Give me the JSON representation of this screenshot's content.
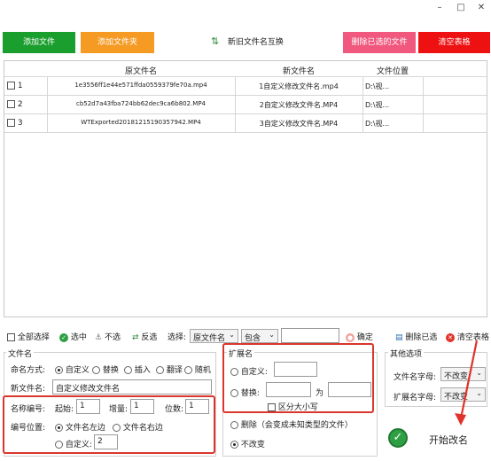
{
  "window": {
    "min_icon": "minimize-icon",
    "max_icon": "maximize-icon",
    "close_icon": "close-icon",
    "min": "–",
    "max": "□",
    "close": "✕"
  },
  "toolbar": {
    "add_file": "添加文件",
    "add_folder": "添加文件夹",
    "swap": "新旧文件名互换",
    "delete_selected": "删除已选的文件",
    "clear_table": "清空表格",
    "colors": {
      "add_file": "#1a9e2e",
      "add_folder": "#f59a23",
      "delete_selected": "#f0587e",
      "clear_table": "#ee1111"
    }
  },
  "table": {
    "headers": [
      "原文件名",
      "新文件名",
      "文件位置"
    ],
    "rows": [
      {
        "num": "1",
        "original": "1e3556ff1e44e571ffda0559379fe70a.mp4",
        "new": "1自定义修改文件名.mp4",
        "location": "D:\\视..."
      },
      {
        "num": "2",
        "original": "cb52d7a43fba724bb62dec9ca6b802.MP4",
        "new": "2自定义修改文件名.MP4",
        "location": "D:\\视..."
      },
      {
        "num": "3",
        "original": "WTExported20181215190357942.MP4",
        "new": "3自定义修改文件名.MP4",
        "location": "D:\\视..."
      }
    ]
  },
  "filterbar": {
    "select_all": "全部选择",
    "select": "选中",
    "deselect": "不选",
    "invert": "反选",
    "choose_label": "选择:",
    "field_value": "原文件名",
    "op_value": "包含",
    "confirm": "确定",
    "delete_selected": "删除已选",
    "clear_table": "清空表格"
  },
  "filename": {
    "legend": "文件名",
    "naming_label": "命名方式:",
    "modes": [
      "自定义",
      "替换",
      "插入",
      "翻译",
      "随机"
    ],
    "new_name_label": "新文件名:",
    "new_name_value": "自定义修改文件名",
    "numbering_label": "名称编号:",
    "start_label": "起始:",
    "start_value": "1",
    "step_label": "增量:",
    "step_value": "1",
    "digits_label": "位数:",
    "digits_value": "1",
    "position_label": "编号位置:",
    "pos_left": "文件名左边",
    "pos_right": "文件名右边",
    "pos_custom": "自定义:",
    "pos_custom_value": "2"
  },
  "extension": {
    "legend": "扩展名",
    "custom": "自定义:",
    "replace": "替换:",
    "as": "为",
    "case_sensitive": "区分大小写",
    "delete": "删除（会变成未知类型的文件）",
    "unchanged": "不改变"
  },
  "other": {
    "legend": "其他选项",
    "name_case_label": "文件名字母:",
    "name_case_value": "不改变",
    "ext_case_label": "扩展名字母:",
    "ext_case_value": "不改变"
  },
  "start_button": "开始改名"
}
